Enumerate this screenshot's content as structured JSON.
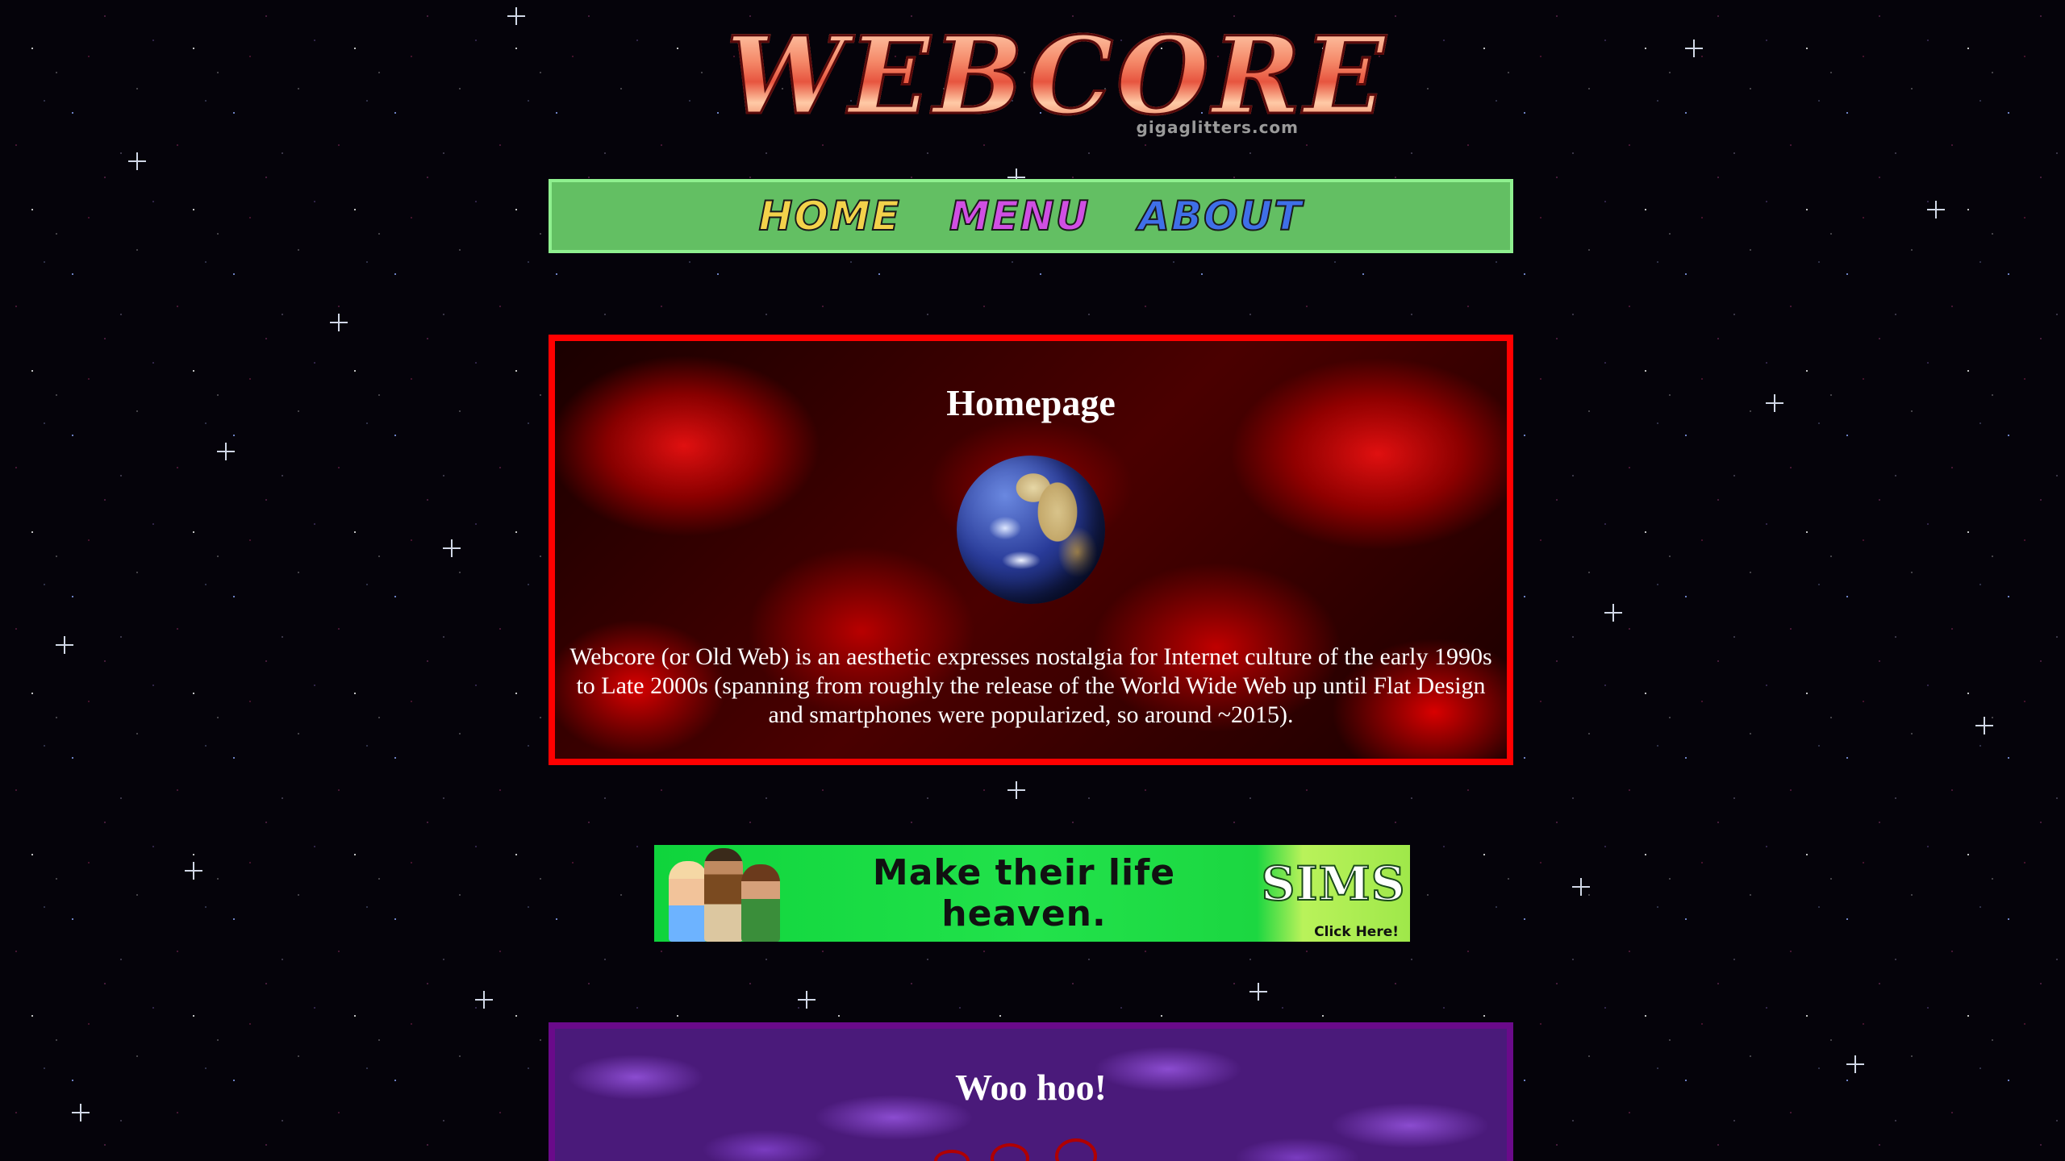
{
  "logo": {
    "text": "WEBCORE",
    "credit": "gigaglitters.com"
  },
  "nav": {
    "items": [
      {
        "label": "HOME"
      },
      {
        "label": "MENU"
      },
      {
        "label": "ABOUT"
      }
    ]
  },
  "homepage": {
    "title": "Homepage",
    "text": "Webcore (or Old Web) is an aesthetic expresses nostalgia for Internet culture of the early 1990s to Late 2000s (spanning from roughly the release of the World Wide Web up until Flat Design and smartphones were popularized, so around ~2015)."
  },
  "ad": {
    "slogan": "Make their life heaven.",
    "logo": "SIMS",
    "cta": "Click Here!"
  },
  "section2": {
    "title": "Woo hoo!"
  },
  "colors": {
    "page_background": "#05030a",
    "nav_background": "#63bf63",
    "homepage_border": "#ff0000",
    "section2_border": "#6a0a8a",
    "ad_background": "#22e24b"
  },
  "icons": [
    "globe-icon",
    "sparkle-icon"
  ]
}
